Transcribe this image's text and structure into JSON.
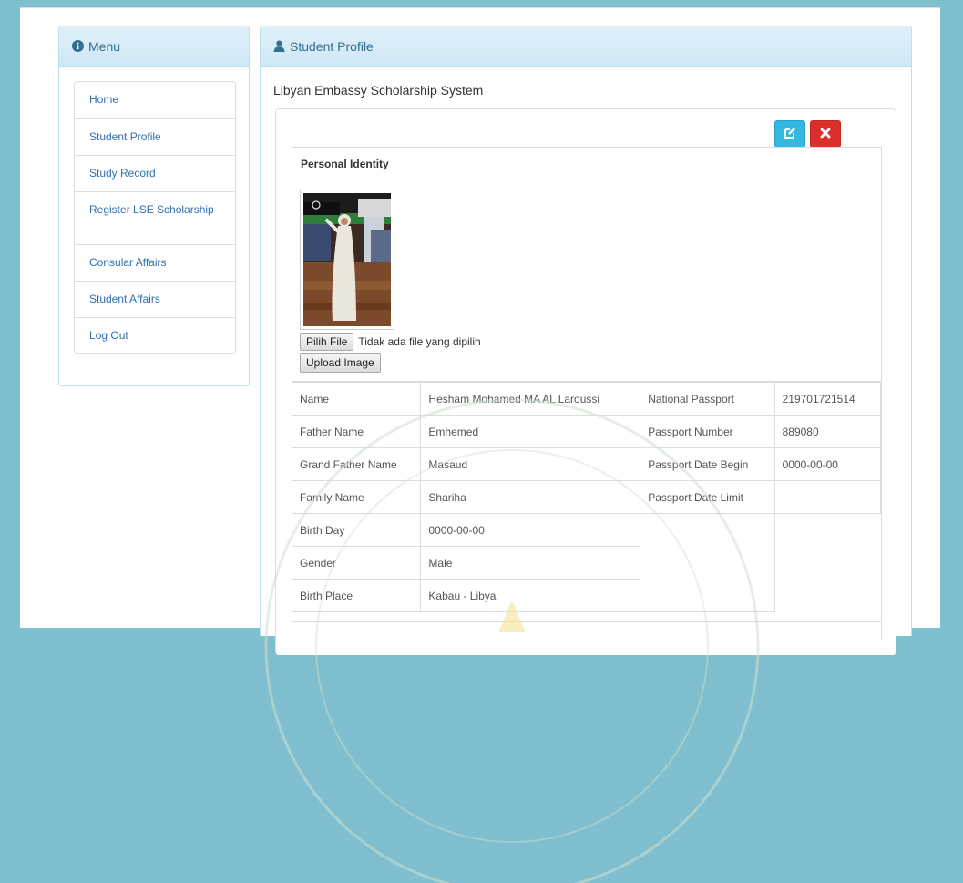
{
  "menu": {
    "title": "Menu",
    "items": [
      {
        "label": "Home"
      },
      {
        "label": "Student Profile"
      },
      {
        "label": "Study Record"
      },
      {
        "label": "Register LSE Scholarship"
      },
      {
        "label": "Consular Affairs"
      },
      {
        "label": "Student Affairs"
      },
      {
        "label": "Log Out"
      }
    ]
  },
  "profile": {
    "title": "Student Profile",
    "system_name": "Libyan Embassy Scholarship System",
    "section_title": "Personal Identity",
    "file_button": "Pilih File",
    "file_status": "Tidak ada file yang dipilih",
    "upload_button": "Upload Image",
    "rows": [
      {
        "label": "Name",
        "value": "Hesham Mohamed MA AL Laroussi",
        "label2": "National Passport",
        "value2": "219701721514"
      },
      {
        "label": "Father Name",
        "value": "Emhemed",
        "label2": "Passport Number",
        "value2": "889080"
      },
      {
        "label": "Grand Father Name",
        "value": "Masaud",
        "label2": "Passport Date Begin",
        "value2": "0000-00-00"
      },
      {
        "label": "Family Name",
        "value": "Shariha",
        "label2": "Passport Date Limit",
        "value2": ""
      },
      {
        "label": "Birth Day",
        "value": "0000-00-00"
      },
      {
        "label": "Gender",
        "value": "Male"
      },
      {
        "label": "Birth Place",
        "value": "Kabau - Libya"
      }
    ]
  },
  "colors": {
    "accent": "#31708f",
    "link": "#2f6fb0",
    "edit_button": "#36b7e0",
    "delete_button": "#d9302a"
  },
  "icons": {
    "menu": "info-circle-icon",
    "profile": "user-icon",
    "edit": "edit-icon",
    "delete": "close-icon"
  }
}
